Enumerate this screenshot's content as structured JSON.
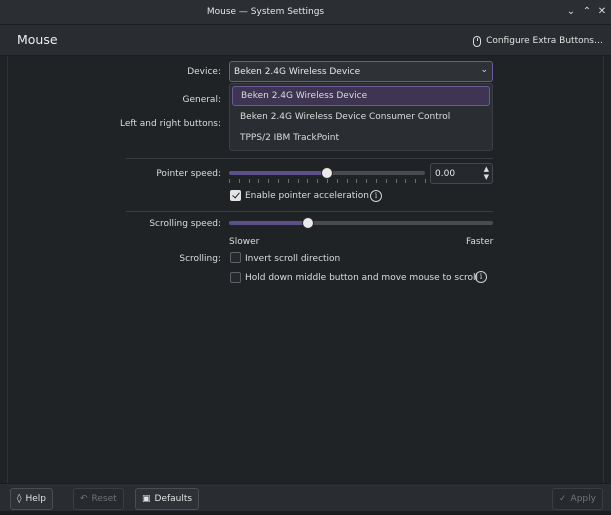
{
  "window": {
    "title": "Mouse — System Settings"
  },
  "header": {
    "page_title": "Mouse",
    "extra_buttons_label": "Configure Extra Buttons…"
  },
  "form": {
    "device_label": "Device:",
    "device_value": "Beken 2.4G Wireless Device",
    "device_options": [
      "Beken 2.4G Wireless Device",
      "Beken 2.4G Wireless Device Consumer Control",
      "TPPS/2 IBM TrackPoint"
    ],
    "general_label": "General:",
    "left_right_label": "Left and right buttons:",
    "pointer_speed_label": "Pointer speed:",
    "pointer_speed_value": "0.00",
    "pointer_speed_level": 0.5,
    "accel_label": "Enable pointer acceleration",
    "accel_checked": true,
    "scroll_speed_label": "Scrolling speed:",
    "scroll_speed_level": 0.3,
    "slower_label": "Slower",
    "faster_label": "Faster",
    "scrolling_label": "Scrolling:",
    "invert_label": "Invert scroll direction",
    "invert_checked": false,
    "middle_label": "Hold down middle button and move mouse to scroll",
    "middle_checked": false
  },
  "footer": {
    "help_label": "Help",
    "reset_label": "Reset",
    "defaults_label": "Defaults",
    "apply_label": "Apply"
  }
}
